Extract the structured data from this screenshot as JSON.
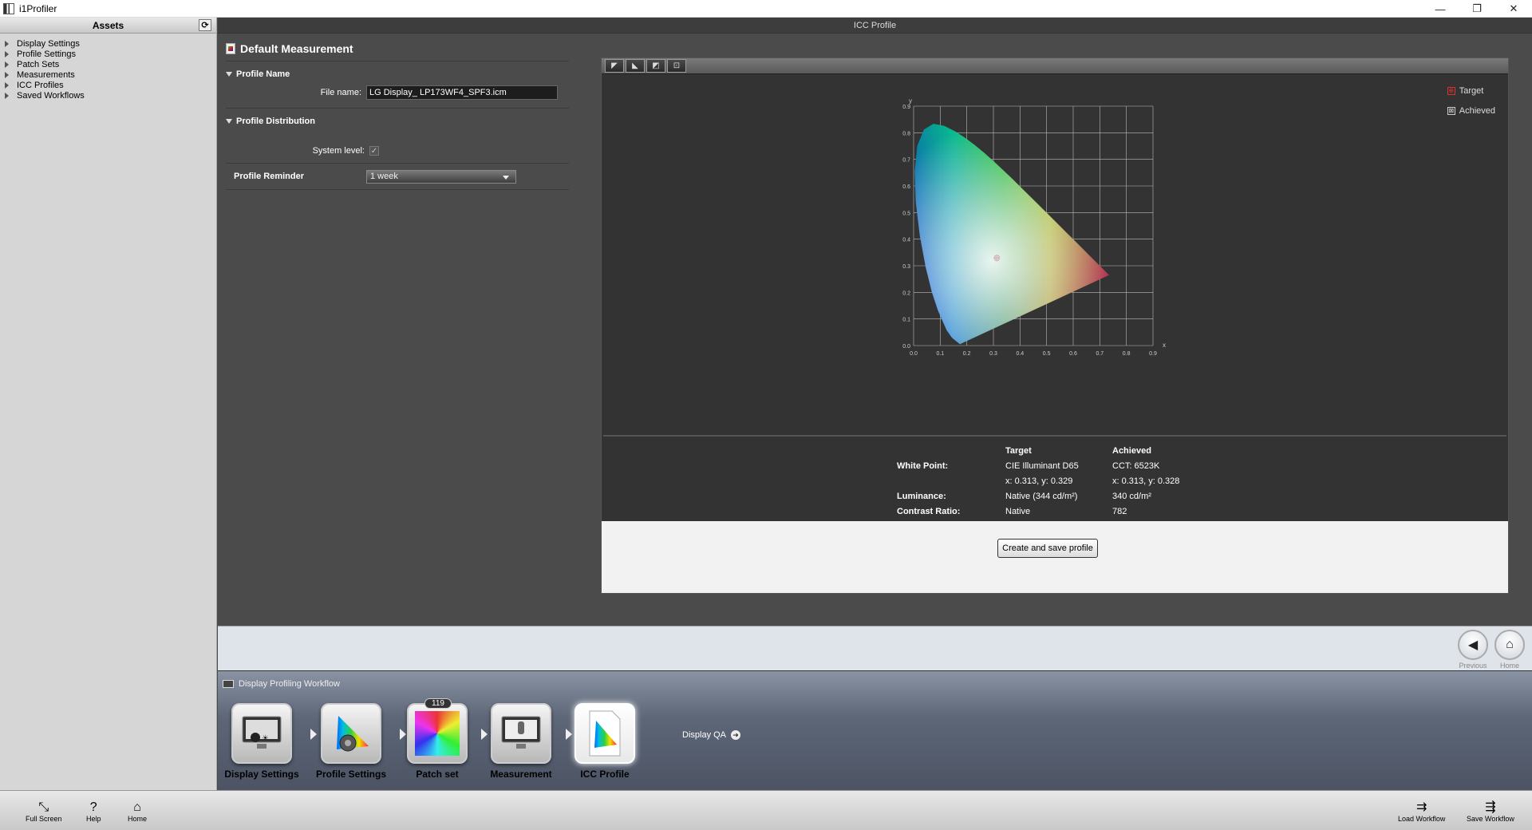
{
  "window": {
    "title": "i1Profiler",
    "minimize": "—",
    "restore": "❐",
    "close": "✕"
  },
  "sidebar": {
    "header": "Assets",
    "refresh_icon": "⟳",
    "items": [
      {
        "label": "Display Settings"
      },
      {
        "label": "Profile Settings"
      },
      {
        "label": "Patch Sets"
      },
      {
        "label": "Measurements"
      },
      {
        "label": "ICC Profiles"
      },
      {
        "label": "Saved Workflows"
      }
    ]
  },
  "main": {
    "band_title": "ICC Profile",
    "panel_title": "Default Measurement",
    "profile_name": {
      "section": "Profile Name",
      "file_label": "File name:",
      "file_value": "LG Display_ LP173WF4_SPF3.icm"
    },
    "profile_distribution": {
      "section": "Profile Distribution",
      "system_label": "System level:",
      "system_checked": true
    },
    "profile_reminder": {
      "label": "Profile Reminder",
      "value": "1 week"
    }
  },
  "chart": {
    "toolbar": [
      "◤",
      "◣",
      "◩",
      "⊡"
    ],
    "legend": [
      {
        "label": "Target",
        "color": "#e03030",
        "mark": "⊕"
      },
      {
        "label": "Achieved",
        "color": "#cccccc",
        "mark": "⊠"
      }
    ]
  },
  "chart_data": {
    "type": "scatter",
    "title": "",
    "xlabel": "x",
    "ylabel": "y",
    "xlim": [
      0.0,
      0.9
    ],
    "ylim": [
      0.0,
      0.9
    ],
    "x_ticks": [
      "0.0",
      "0.1",
      "0.2",
      "0.3",
      "0.4",
      "0.5",
      "0.6",
      "0.7",
      "0.8",
      "0.9"
    ],
    "y_ticks": [
      "0.0",
      "0.1",
      "0.2",
      "0.3",
      "0.4",
      "0.5",
      "0.6",
      "0.7",
      "0.8",
      "0.9"
    ],
    "grid": true,
    "series": [
      {
        "name": "Target",
        "x": [
          0.313
        ],
        "y": [
          0.329
        ]
      },
      {
        "name": "Achieved",
        "x": [
          0.313
        ],
        "y": [
          0.328
        ]
      }
    ]
  },
  "results": {
    "col_target": "Target",
    "col_achieved": "Achieved",
    "white_point_label": "White Point:",
    "white_point_target": "CIE Illuminant D65",
    "white_point_achieved": "CCT: 6523K",
    "xy_target": "x: 0.313, y: 0.329",
    "xy_achieved": "x: 0.313, y: 0.328",
    "luminance_label": "Luminance:",
    "luminance_target": "Native (344 cd/m²)",
    "luminance_achieved": "340 cd/m²",
    "contrast_label": "Contrast Ratio:",
    "contrast_target": "Native",
    "contrast_achieved": "782"
  },
  "create_button": "Create and save profile",
  "nav": {
    "previous": "Previous",
    "home": "Home"
  },
  "workflow": {
    "title": "Display Profiling Workflow",
    "steps": [
      {
        "label": "Display Settings"
      },
      {
        "label": "Profile Settings"
      },
      {
        "label": "Patch set",
        "badge": "119"
      },
      {
        "label": "Measurement"
      },
      {
        "label": "ICC Profile"
      }
    ],
    "display_qa": "Display QA"
  },
  "bottom": {
    "full_screen": "Full Screen",
    "help": "Help",
    "home": "Home",
    "load_workflow": "Load Workflow",
    "save_workflow": "Save Workflow"
  }
}
